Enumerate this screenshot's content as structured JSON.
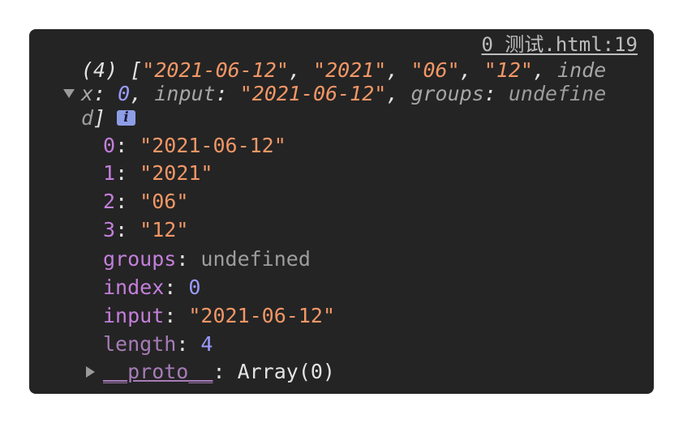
{
  "source_link": "0 测试.html:19",
  "summary": {
    "count": "(4)",
    "open_bracket": "[",
    "items": [
      "\"2021-06-12\"",
      "\"2021\"",
      "\"06\"",
      "\"12\""
    ],
    "sep": ", ",
    "index_key_part1": "inde",
    "index_key_part2": "x",
    "colon": ": ",
    "index_val": "0",
    "input_key": "input",
    "input_val": "\"2021-06-12\"",
    "groups_key": "groups",
    "groups_val_part1": "undefine",
    "groups_val_part2": "d",
    "close_bracket": "]"
  },
  "info_badge": "i",
  "entries": [
    {
      "key": "0",
      "value": "\"2021-06-12\""
    },
    {
      "key": "1",
      "value": "\"2021\""
    },
    {
      "key": "2",
      "value": "\"06\""
    },
    {
      "key": "3",
      "value": "\"12\""
    }
  ],
  "groups": {
    "key": "groups",
    "value": "undefined"
  },
  "index": {
    "key": "index",
    "value": "0"
  },
  "input": {
    "key": "input",
    "value": "\"2021-06-12\""
  },
  "length": {
    "key": "length",
    "value": "4"
  },
  "proto": {
    "key": "__proto__",
    "value": "Array(0)"
  }
}
